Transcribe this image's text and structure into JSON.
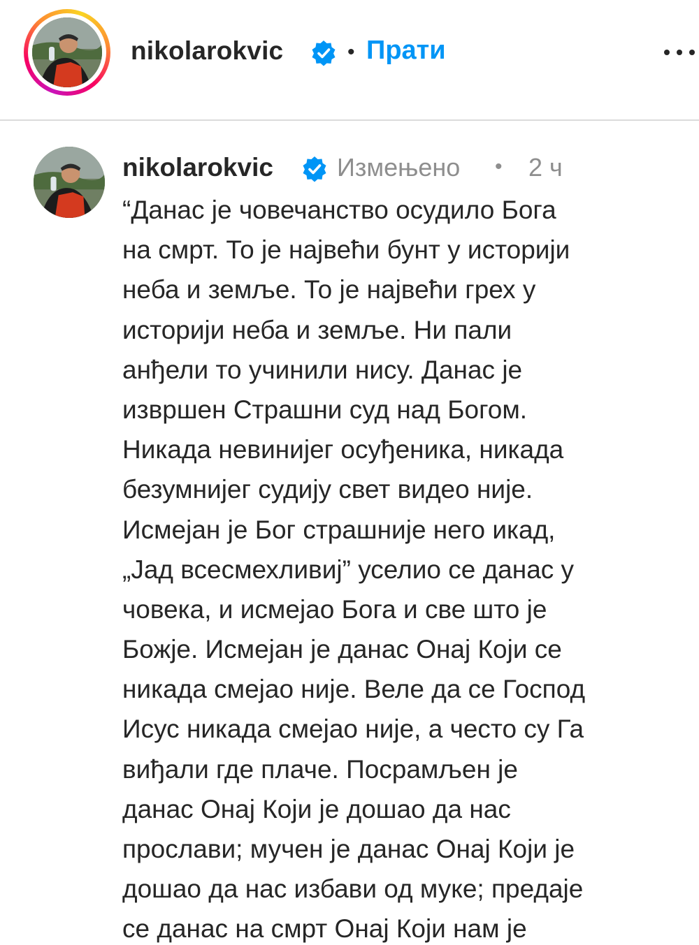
{
  "header": {
    "username": "nikolarokvic",
    "follow_label": "Прати",
    "separator": "•"
  },
  "caption": {
    "username": "nikolarokvic",
    "edited_label": "Измењено",
    "separator": "•",
    "time": "2 ч",
    "lines": [
      "“Данас је човечанство осудило Бога",
      "на смрт. То је највећи бунт у историји",
      "неба и земље. То је највећи грех у",
      "историји неба и земље. Ни пали",
      "анђели то учинили нису. Данас је",
      "извршен Страшни суд над Богом.",
      "Никада невинијег осуђеника, никада",
      "безумнијег судију свет видео није.",
      "Исмејан је Бог страшније него икад,",
      "„Јад всесмехливиј” уселио се данас у",
      "човека, и исмејао Бога и све што је",
      "Божје. Исмејан је данас Онај Који се",
      "никада смејао није. Веле да се Господ",
      "Исус никада смејао није, а често су Га",
      "виђали где плаче. Посрамљен је",
      "данас Онај Који је дошао да нас",
      "прослави; мучен је данас Онај Који је",
      "дошао да нас избави од муке; предаје",
      "се данас на смрт Онај Који нам је"
    ]
  },
  "icons": {
    "verified": "verified-badge-icon",
    "more": "more-options-icon",
    "avatar": "profile-avatar"
  },
  "colors": {
    "follow_blue": "#0095f6",
    "verified_blue": "#0095f6",
    "muted_gray": "#8e8e8e",
    "text": "#262626"
  }
}
